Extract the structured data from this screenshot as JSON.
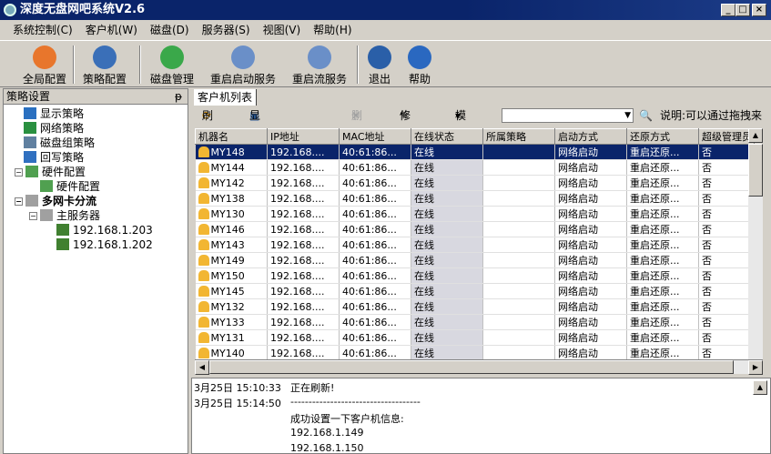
{
  "window": {
    "title": "深度无盘网吧系统V2.6",
    "min": "_",
    "max": "□",
    "close": "×"
  },
  "menu": [
    "系统控制(C)",
    "客户机(W)",
    "磁盘(D)",
    "服务器(S)",
    "视图(V)",
    "帮助(H)"
  ],
  "toolbar": [
    {
      "label": "全局配置",
      "color": "#e8762c"
    },
    {
      "label": "策略配置",
      "color": "#3a6fb8"
    },
    {
      "label": "磁盘管理",
      "color": "#3aa84a"
    },
    {
      "label": "重启启动服务",
      "color": "#6a8fc8"
    },
    {
      "label": "重启流服务",
      "color": "#6a8fc8"
    },
    {
      "label": "退出",
      "color": "#2a5fa8"
    },
    {
      "label": "帮助",
      "color": "#2a68c0"
    }
  ],
  "left_panel": {
    "title": "策略设置",
    "pin": "ᵽ",
    "tree": [
      {
        "label": "显示策略",
        "color": "#2a70c0"
      },
      {
        "label": "网络策略",
        "color": "#2a9040"
      },
      {
        "label": "磁盘组策略",
        "color": "#6080a0"
      },
      {
        "label": "回写策略",
        "color": "#3070c0"
      },
      {
        "label": "硬件配置",
        "color": "#50a050"
      },
      {
        "label": "硬件配置",
        "color": "#50a050"
      },
      {
        "label": "多网卡分流",
        "color": "#a0a0a0"
      },
      {
        "label": "主服务器",
        "color": "#a0a0a0"
      },
      {
        "label": "192.168.1.203",
        "color": "#408030"
      },
      {
        "label": "192.168.1.202",
        "color": "#408030"
      }
    ]
  },
  "clients": {
    "tab": "客户机列表",
    "tools": {
      "refresh": "刷新",
      "show_all": "显示所有客户机",
      "delete": "删除",
      "modify": "修改",
      "mode": "模式",
      "search": "",
      "note": "说明:可以通过拖拽来"
    },
    "columns": [
      "机器名",
      "IP地址",
      "MAC地址",
      "在线状态",
      "所属策略",
      "启动方式",
      "还原方式",
      "超级管理员"
    ],
    "rows": [
      [
        "MY148",
        "192.168....",
        "40:61:86...",
        "在线",
        "",
        "网络启动",
        "重启还原...",
        "否"
      ],
      [
        "MY144",
        "192.168....",
        "40:61:86...",
        "在线",
        "",
        "网络启动",
        "重启还原...",
        "否"
      ],
      [
        "MY142",
        "192.168....",
        "40:61:86...",
        "在线",
        "",
        "网络启动",
        "重启还原...",
        "否"
      ],
      [
        "MY138",
        "192.168....",
        "40:61:86...",
        "在线",
        "",
        "网络启动",
        "重启还原...",
        "否"
      ],
      [
        "MY130",
        "192.168....",
        "40:61:86...",
        "在线",
        "",
        "网络启动",
        "重启还原...",
        "否"
      ],
      [
        "MY146",
        "192.168....",
        "40:61:86...",
        "在线",
        "",
        "网络启动",
        "重启还原...",
        "否"
      ],
      [
        "MY143",
        "192.168....",
        "40:61:86...",
        "在线",
        "",
        "网络启动",
        "重启还原...",
        "否"
      ],
      [
        "MY149",
        "192.168....",
        "40:61:86...",
        "在线",
        "",
        "网络启动",
        "重启还原...",
        "否"
      ],
      [
        "MY150",
        "192.168....",
        "40:61:86...",
        "在线",
        "",
        "网络启动",
        "重启还原...",
        "否"
      ],
      [
        "MY145",
        "192.168....",
        "40:61:86...",
        "在线",
        "",
        "网络启动",
        "重启还原...",
        "否"
      ],
      [
        "MY132",
        "192.168....",
        "40:61:86...",
        "在线",
        "",
        "网络启动",
        "重启还原...",
        "否"
      ],
      [
        "MY133",
        "192.168....",
        "40:61:86...",
        "在线",
        "",
        "网络启动",
        "重启还原...",
        "否"
      ],
      [
        "MY131",
        "192.168....",
        "40:61:86...",
        "在线",
        "",
        "网络启动",
        "重启还原...",
        "否"
      ],
      [
        "MY140",
        "192.168....",
        "40:61:86...",
        "在线",
        "",
        "网络启动",
        "重启还原...",
        "否"
      ]
    ]
  },
  "log": [
    {
      "time": "3月25日 15:10:33",
      "msg": "正在刷新!"
    },
    {
      "time": "3月25日 15:14:50",
      "msg": "------------------------------------"
    },
    {
      "time": "",
      "msg": "成功设置一下客户机信息:"
    },
    {
      "time": "",
      "msg": "192.168.1.149"
    },
    {
      "time": "",
      "msg": "192.168.1.150"
    }
  ]
}
